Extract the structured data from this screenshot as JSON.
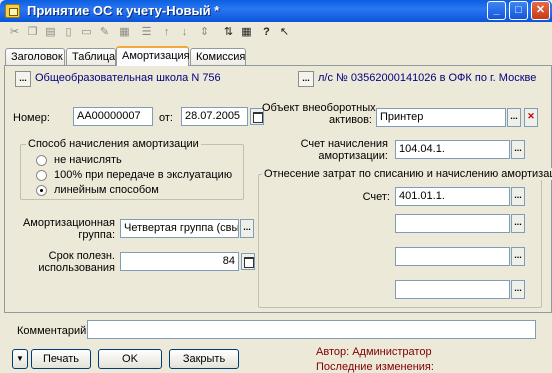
{
  "window": {
    "title": "Принятие ОС к учету-Новый *"
  },
  "window_controls": {
    "minimize": "_",
    "maximize": "□",
    "close": "✕"
  },
  "toolbar": {
    "icons": [
      "cut-icon",
      "copy-icon",
      "paste-icon",
      "page-icon",
      "copy-doc-icon",
      "edit-icon",
      "arrow-up-icon",
      "arrow-down-icon",
      "move-icon",
      "sort-icon",
      "help-icon",
      "pointer-help-icon"
    ]
  },
  "tabs": [
    {
      "label": "Заголовок",
      "active": false
    },
    {
      "label": "Таблица",
      "active": false
    },
    {
      "label": "Амортизация",
      "active": true
    },
    {
      "label": "Комиссия",
      "active": false
    }
  ],
  "header": {
    "organization": "Общеобразовательная школа N 756",
    "account": "л/с № 03562000141026 в ОФК по г. Москве"
  },
  "form": {
    "number_label": "Номер:",
    "number_value": "АА00000007",
    "date_label": "от:",
    "date_value": "28.07.2005",
    "asset_label_line1": "Объект внеоборотных",
    "asset_label_line2": "активов:",
    "asset_value": "Принтер"
  },
  "depreciation_method": {
    "title": "Способ начисления амортизации",
    "options": [
      {
        "label": "не начислять",
        "checked": false
      },
      {
        "label": "100% при передаче в экслуатацию",
        "checked": false
      },
      {
        "label": "линейным способом",
        "checked": true
      }
    ]
  },
  "depreciation_account": {
    "label_line1": "Счет начисления",
    "label_line2": "амортизации:",
    "value": "104.04.1."
  },
  "cost_allocation": {
    "title": "Отнесение затрат по списанию и начислению амортизации",
    "account_label": "Счет:",
    "account_value": "401.01.1.",
    "subconto_values": [
      "",
      "",
      ""
    ]
  },
  "depreciation_group": {
    "label_line1": "Амортизационная",
    "label_line2": "группа:",
    "value": "Четвертая группа (свыш"
  },
  "useful_life": {
    "label_line1": "Срок полезн.",
    "label_line2": "использования",
    "value": "84"
  },
  "comment": {
    "label": "Комментарий:",
    "value": ""
  },
  "buttons": {
    "menu": "▼",
    "print": "Печать",
    "ok": "OK",
    "close": "Закрыть",
    "ellipsis": "...",
    "clear": "✕"
  },
  "footer": {
    "author": "Автор: Администратор",
    "last_changes": "Последние изменения:"
  }
}
